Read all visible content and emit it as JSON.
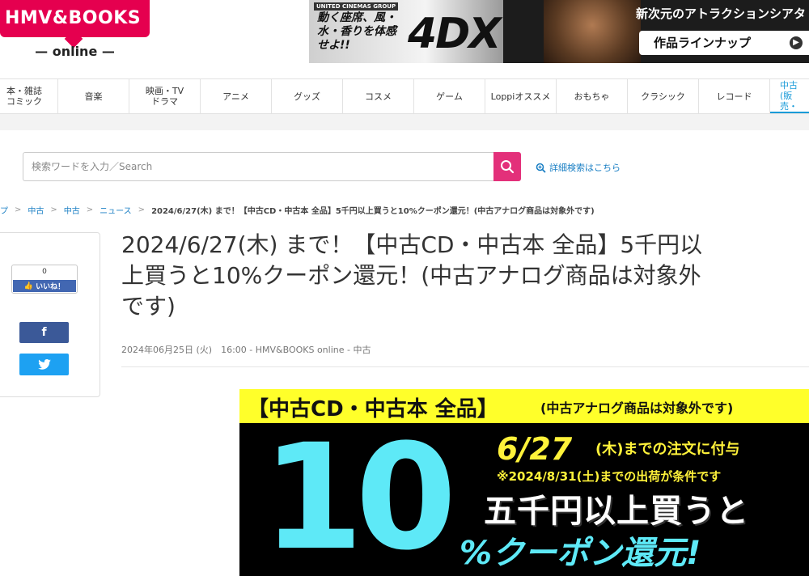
{
  "header": {
    "logo_text": "HMV&BOOKS",
    "logo_sub": "— online —",
    "banner": {
      "brand": "UNITED CINEMAS GROUP",
      "catch": "動く座席、風・水・香りを体感せよ!!",
      "logo": "4DX",
      "headline": "新次元のアトラクションシアタ",
      "button": "作品ラインナップ"
    }
  },
  "nav": {
    "items": [
      {
        "label": "本・雑誌\nコミック"
      },
      {
        "label": "音楽"
      },
      {
        "label": "映画・TV\nドラマ"
      },
      {
        "label": "アニメ"
      },
      {
        "label": "グッズ"
      },
      {
        "label": "コスメ"
      },
      {
        "label": "ゲーム"
      },
      {
        "label": "Loppiオススメ"
      },
      {
        "label": "おもちゃ"
      },
      {
        "label": "クラシック"
      },
      {
        "label": "レコード"
      },
      {
        "label": "中古\n(販売・"
      }
    ]
  },
  "search": {
    "placeholder": "検索ワードを入力／Search",
    "advanced_label": "詳細検索はこちら"
  },
  "breadcrumb": {
    "items": [
      "プ",
      "中古",
      "中古",
      "ニュース"
    ],
    "current": "2024/6/27(木) まで！【中古CD・中古本 全品】5千円以上買うと10%クーポン還元！(中古アナログ商品は対象外です)"
  },
  "share": {
    "like_count": "0",
    "like_label": "いいね！",
    "facebook_label": "f"
  },
  "article": {
    "title_line1": "2024/6/27(木) まで！【中古CD・中古本 全品】5千円以",
    "title_line2": "上買うと10%クーポン還元！(中古アナログ商品は対象外",
    "title_line3": "です)",
    "meta": "2024年06月25日 (火)　16:00 - HMV&BOOKS online - 中古"
  },
  "promo": {
    "header_big": "【中古CD・中古本 全品】",
    "header_small": "(中古アナログ商品は対象外です)",
    "ten": "10",
    "date": "6/27",
    "date_rest": "(木)までの注文に付与",
    "note": "※2024/8/31(土)までの出荷が条件です",
    "line1": "五千円以上買うと",
    "line2": "%クーポン還元!"
  },
  "colors": {
    "brand_pink": "#e5004f",
    "search_button": "#e3307a",
    "link_blue": "#1a7fc4",
    "nav_active": "#1a9bd8",
    "promo_yellow": "#ffff2a",
    "promo_cyan": "#5ee9f7"
  }
}
